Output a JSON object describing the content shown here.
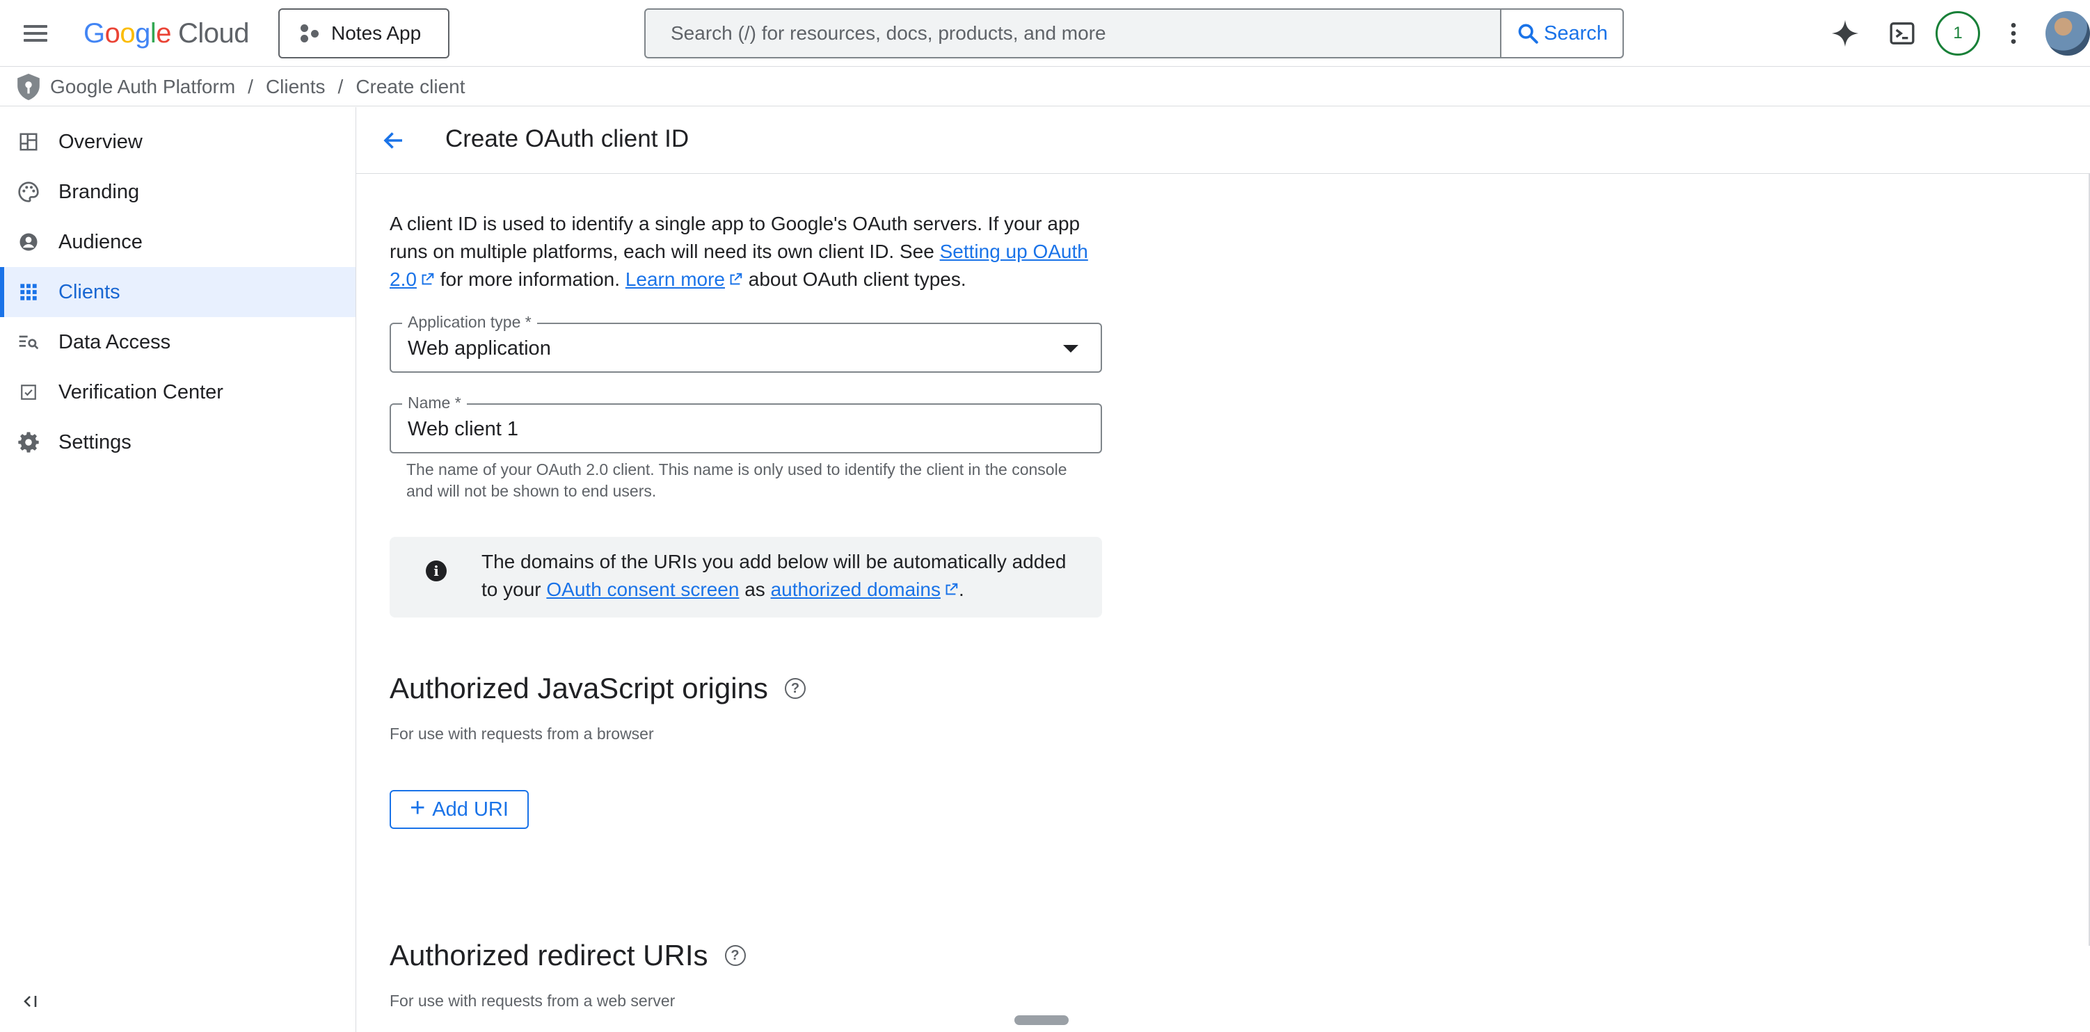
{
  "topbar": {
    "logo_google": "Google",
    "logo_cloud": "Cloud",
    "project_label": "Notes App",
    "search_placeholder": "Search (/) for resources, docs, products, and more",
    "search_button": "Search",
    "notification_count": "1",
    "icons": [
      "menu-icon",
      "gemini-sparkle-icon",
      "cloud-shell-icon",
      "more-vert-icon"
    ]
  },
  "breadcrumb": {
    "items": [
      "Google Auth Platform",
      "Clients",
      "Create client"
    ],
    "separator": "/"
  },
  "sidebar": {
    "items": [
      {
        "label": "Overview",
        "icon": "dashboard-icon"
      },
      {
        "label": "Branding",
        "icon": "palette-icon"
      },
      {
        "label": "Audience",
        "icon": "account-circle-icon"
      },
      {
        "label": "Clients",
        "icon": "apps-grid-icon",
        "active": true
      },
      {
        "label": "Data Access",
        "icon": "manage-search-icon"
      },
      {
        "label": "Verification Center",
        "icon": "checklist-icon"
      },
      {
        "label": "Settings",
        "icon": "gear-icon"
      }
    ],
    "collapse_label": "<|"
  },
  "main": {
    "title": "Create OAuth client ID",
    "intro_text_1": "A client ID is used to identify a single app to Google's OAuth servers. If your app runs on multiple platforms, each will need its own client ID. See ",
    "intro_link_1": "Setting up OAuth 2.0",
    "intro_text_2": " for more information. ",
    "intro_link_2": "Learn more",
    "intro_text_3": " about OAuth client types.",
    "app_type_label": "Application type *",
    "app_type_value": "Web application",
    "name_label": "Name *",
    "name_value": "Web client 1",
    "name_helper": "The name of your OAuth 2.0 client. This name is only used to identify the client in the console and will not be shown to end users.",
    "info_text_1": "The domains of the URIs you add below will be automatically added to your ",
    "info_link_1": "OAuth consent screen",
    "info_text_2": " as ",
    "info_link_2": "authorized domains",
    "info_text_3": ".",
    "js_origins_title": "Authorized JavaScript origins",
    "js_origins_sub": "For use with requests from a browser",
    "add_uri_label": "Add URI",
    "redirect_title": "Authorized redirect URIs",
    "redirect_sub": "For use with requests from a web server"
  },
  "colors": {
    "accent": "#1a73e8",
    "active_bg": "#e8f0fe",
    "notification": "#188038",
    "info_bg": "#f1f3f4"
  }
}
